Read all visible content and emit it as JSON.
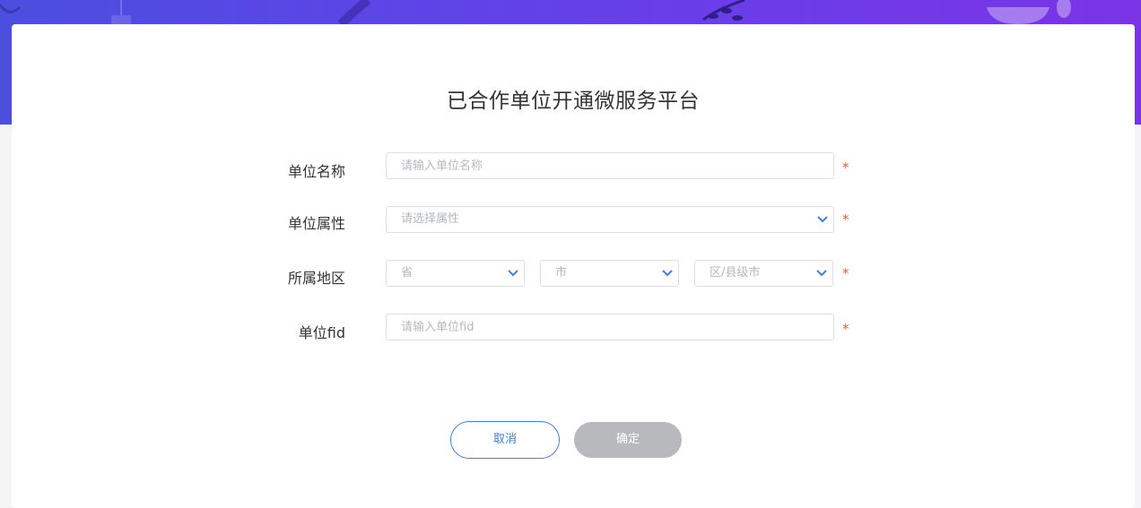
{
  "form": {
    "title": "已合作单位开通微服务平台",
    "unit_name": {
      "label": "单位名称",
      "placeholder": "请输入单位名称",
      "required_mark": "*"
    },
    "unit_attr": {
      "label": "单位属性",
      "placeholder": "请选择属性",
      "required_mark": "*"
    },
    "region": {
      "label": "所属地区",
      "province": "省",
      "city": "市",
      "district": "区/县级市",
      "required_mark": "*"
    },
    "unit_fid": {
      "label": "单位fid",
      "placeholder": "请输入单位fid",
      "required_mark": "*"
    }
  },
  "buttons": {
    "cancel": "取消",
    "confirm": "确定"
  },
  "colors": {
    "banner_start": "#4c4ee0",
    "banner_end": "#7a34e6",
    "accent": "#3f7fe8",
    "required": "#f05a28",
    "disabled_button": "#b7b9bd"
  },
  "icons": {
    "select_arrow": "chevron-down-icon"
  }
}
